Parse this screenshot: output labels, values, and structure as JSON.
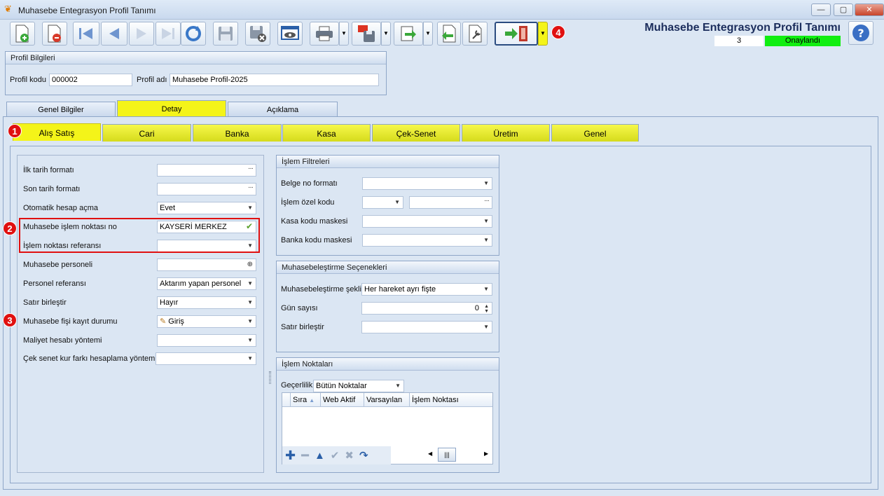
{
  "window": {
    "title": "Muhasebe Entegrasyon Profil Tanımı"
  },
  "header": {
    "title": "Muhasebe Entegrasyon Profil Tanımı",
    "status_number": "3",
    "status_text": "Onaylandı",
    "help_icon": "help-icon"
  },
  "badges": {
    "b1": "1",
    "b2": "2",
    "b3": "3",
    "b4": "4"
  },
  "profile": {
    "group_title": "Profil Bilgileri",
    "code_label": "Profil kodu",
    "code_value": "000002",
    "name_label": "Profil adı",
    "name_value": "Muhasebe Profil-2025"
  },
  "main_tabs": [
    "Genel Bilgiler",
    "Detay",
    "Açıklama"
  ],
  "sub_tabs": [
    "Alış Satış",
    "Cari",
    "Banka",
    "Kasa",
    "Çek-Senet",
    "Üretim",
    "Genel"
  ],
  "left_form": {
    "ilk_tarih_label": "İlk tarih formatı",
    "ilk_tarih_value": "",
    "son_tarih_label": "Son tarih formatı",
    "son_tarih_value": "",
    "otomatik_label": "Otomatik hesap açma",
    "otomatik_value": "Evet",
    "islem_noktasi_label": "Muhasebe işlem noktası no",
    "islem_noktasi_value": "KAYSERİ MERKEZ",
    "islem_ref_label": "İşlem noktası referansı",
    "islem_ref_value": "",
    "personel_label": "Muhasebe personeli",
    "personel_value": "",
    "personel_ref_label": "Personel referansı",
    "personel_ref_value": "Aktarım yapan personel",
    "satir_label": "Satır birleştir",
    "satir_value": "Hayır",
    "fis_label": "Muhasebe fişi kayıt durumu",
    "fis_value": "Giriş",
    "maliyet_label": "Maliyet hesabı yöntemi",
    "maliyet_value": "",
    "cek_label": "Çek senet kur farkı hesaplama yöntemi",
    "cek_value": ""
  },
  "islem_filtreleri": {
    "title": "İşlem Filtreleri",
    "belge_label": "Belge no formatı",
    "ozel_label": "İşlem özel kodu",
    "kasa_label": "Kasa kodu maskesi",
    "banka_label": "Banka kodu maskesi"
  },
  "muhasebe_secenekleri": {
    "title": "Muhasebeleştirme Seçenekleri",
    "sekil_label": "Muhasebeleştirme şekli",
    "sekil_value": "Her hareket ayrı fişte",
    "gun_label": "Gün sayısı",
    "gun_value": "0",
    "satir_label": "Satır birleştir",
    "satir_value": ""
  },
  "islem_noktalari": {
    "title": "İşlem Noktaları",
    "gecerlilik_label": "Geçerlilik",
    "gecerlilik_value": "Bütün Noktalar",
    "columns": [
      "Sıra",
      "Web Aktif",
      "Varsayılan",
      "İşlem Noktası"
    ]
  },
  "icons": [
    "new-record-icon",
    "delete-record-icon",
    "first-record-icon",
    "previous-record-icon",
    "next-record-icon",
    "last-record-icon",
    "refresh-icon",
    "save-icon",
    "save-close-icon",
    "preview-icon",
    "print-icon",
    "pdf-save-icon",
    "export-icon",
    "back-icon",
    "tools-icon",
    "exit-icon"
  ],
  "colors": {
    "active_tab": "#f4f419",
    "status_ok": "#11ee11",
    "badge": "#e01010",
    "heading": "#1b2d5c"
  }
}
